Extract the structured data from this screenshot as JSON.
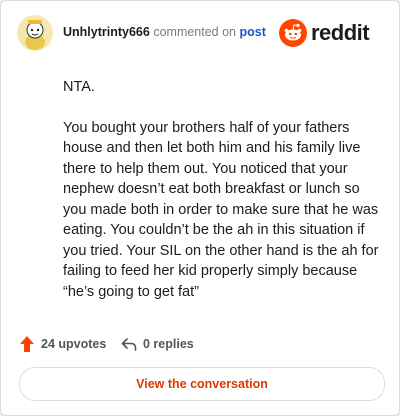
{
  "header": {
    "username": "Unhlytrinty666",
    "commented_on": "commented on",
    "post_link": "post",
    "brand_name": "reddit"
  },
  "comment": {
    "paragraphs": [
      "NTA.",
      "You bought your brothers half of your fathers house and then let both him and his family live there to help them out. You noticed that your nephew doesn’t eat both breakfast or lunch so you made both in order to make sure that he was eating. You couldn’t be the ah in this situation if you tried. Your SIL on the other hand is the ah for failing to feed her kid properly simply because “he’s going to get fat”"
    ]
  },
  "actions": {
    "upvotes": "24 upvotes",
    "replies": "0 replies"
  },
  "footer": {
    "view_button": "View the conversation"
  },
  "colors": {
    "accent": "#d93a00",
    "reddit_orange": "#ff4500",
    "link_blue": "#1a57c4"
  },
  "icons": {
    "avatar": "snoo-avatar-icon",
    "logo": "reddit-snoo-icon",
    "upvote": "upvote-arrow-icon",
    "reply": "reply-arrow-icon"
  }
}
